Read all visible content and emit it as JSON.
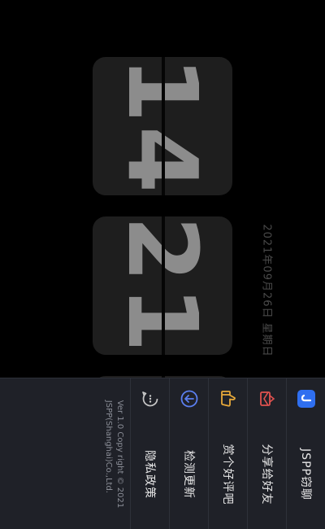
{
  "clock": {
    "hour": "14",
    "minute": "21",
    "date": "2021年09月26日 星期日"
  },
  "menu": {
    "items": [
      {
        "label": "JSPP窃聊",
        "icon": "app-logo-icon"
      },
      {
        "label": "分享给好友",
        "icon": "share-icon"
      },
      {
        "label": "赏个好评吧",
        "icon": "thumbs-up-icon"
      },
      {
        "label": "检测更新",
        "icon": "update-arrow-icon"
      },
      {
        "label": "隐私政策",
        "icon": "privacy-chat-icon"
      }
    ],
    "copyright_line1": "Ver 1.0 Copy right © 2021",
    "copyright_line2": "JSPP(Shanghai)Co.,Ltd."
  },
  "colors": {
    "accent_blue": "#2f6ff0",
    "share_red": "#e0524f",
    "like_yellow": "#e8a93a",
    "update_blue": "#5b7ff0"
  }
}
